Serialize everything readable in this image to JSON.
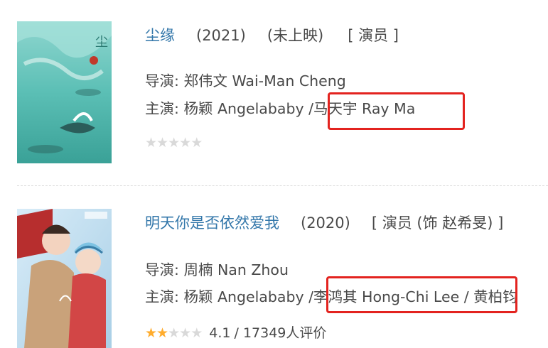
{
  "items": [
    {
      "title": "尘缘",
      "year": "(2021)",
      "status": "(未上映)",
      "role": "[ 演员 ]",
      "director_label": "导演:",
      "director": "郑伟文 Wai-Man Cheng",
      "cast_label": "主演:",
      "cast_before": "杨颖 Angelababy /",
      "cast_highlight": "马天宇 Ray Ma",
      "cast_after": "",
      "rating": {
        "filled": 0,
        "total": 5,
        "score": "",
        "count_text": ""
      }
    },
    {
      "title": "明天你是否依然爱我",
      "year": "(2020)",
      "status": "",
      "role": "[ 演员 (饰 赵希旻) ]",
      "director_label": "导演:",
      "director": "周楠 Nan Zhou",
      "cast_label": "主演:",
      "cast_before": "杨颖 Angelababy /",
      "cast_highlight": "李鸿其 Hong-Chi Lee",
      "cast_after": "/ 黄柏钧",
      "rating": {
        "filled": 2,
        "total": 5,
        "score": "4.1",
        "count_text": "/ 17349人评价"
      }
    }
  ],
  "colors": {
    "link": "#3377aa",
    "highlight": "#e3231f",
    "star": "#ffac2d",
    "star_empty": "#d9d9d9"
  }
}
